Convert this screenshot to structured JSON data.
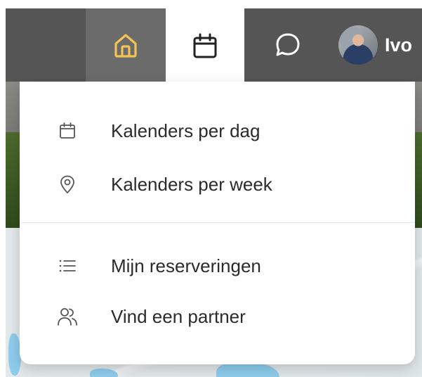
{
  "header": {
    "nav": {
      "home_icon": "home-icon",
      "calendar_icon": "calendar-icon",
      "chat_icon": "chat-bubble-icon",
      "profile_name": "Ivo"
    },
    "colors": {
      "bar": "#555555",
      "home_accent": "#f1c453",
      "active_tab": "#ffffff"
    }
  },
  "dropdown": {
    "items": [
      {
        "label": "Kalenders per dag",
        "icon": "calendar-icon"
      },
      {
        "label": "Kalenders per week",
        "icon": "location-pin-icon"
      },
      {
        "label": "Mijn reserveringen",
        "icon": "list-icon"
      },
      {
        "label": "Vind een partner",
        "icon": "users-icon"
      }
    ]
  }
}
